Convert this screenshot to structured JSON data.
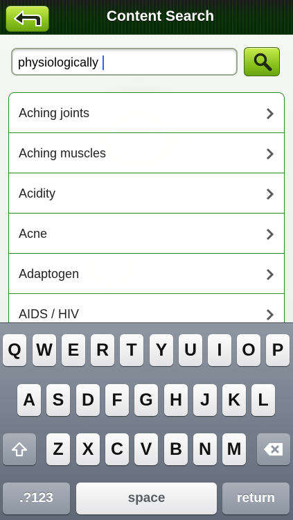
{
  "header": {
    "title": "Content Search",
    "back_icon": "back-arrow-icon"
  },
  "search": {
    "value": "physiologically",
    "button_icon": "magnifier-icon"
  },
  "list": {
    "items": [
      {
        "label": "Aching joints"
      },
      {
        "label": "Aching muscles"
      },
      {
        "label": "Acidity"
      },
      {
        "label": "Acne"
      },
      {
        "label": "Adaptogen"
      },
      {
        "label": "AIDS / HIV"
      }
    ],
    "chevron_icon": "chevron-right-icon"
  },
  "keyboard": {
    "row1": [
      "Q",
      "W",
      "E",
      "R",
      "T",
      "Y",
      "U",
      "I",
      "O",
      "P"
    ],
    "row2": [
      "A",
      "S",
      "D",
      "F",
      "G",
      "H",
      "J",
      "K",
      "L"
    ],
    "row3": [
      "Z",
      "X",
      "C",
      "V",
      "B",
      "N",
      "M"
    ],
    "numbers_label": ".?123",
    "space_label": "space",
    "return_label": "return",
    "shift_icon": "shift-arrow-icon",
    "delete_icon": "backspace-icon"
  },
  "colors": {
    "accent_green": "#8fc61e",
    "list_border": "#2a8a2a",
    "cursor": "#2b64ff"
  }
}
